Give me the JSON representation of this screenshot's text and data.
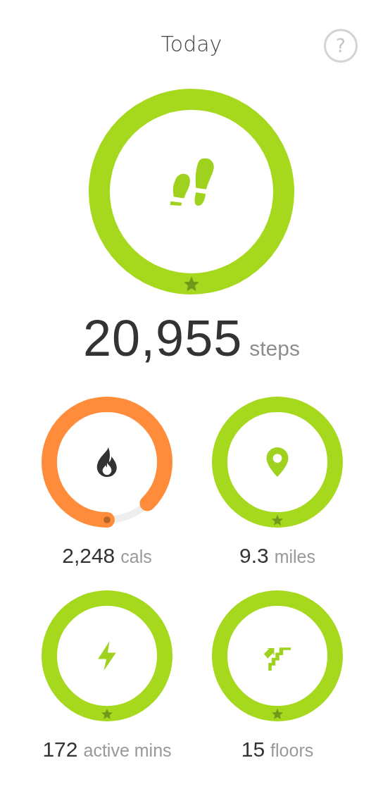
{
  "header": {
    "title": "Today",
    "help_label": "?"
  },
  "main_stat": {
    "kind": "steps",
    "value": "20,955",
    "unit": "steps",
    "level": 1,
    "goal_met": true
  },
  "stats": [
    {
      "kind": "calories",
      "value": "2,248",
      "unit": "cals",
      "level": 0.875,
      "goal_met": false
    },
    {
      "kind": "distance",
      "value": "9.3",
      "unit": "miles",
      "level": 1,
      "goal_met": true
    },
    {
      "kind": "active",
      "value": "172",
      "unit": "active mins",
      "level": 1,
      "goal_met": true
    },
    {
      "kind": "floors",
      "value": "15",
      "unit": "floors",
      "level": 1,
      "goal_met": true
    }
  ]
}
